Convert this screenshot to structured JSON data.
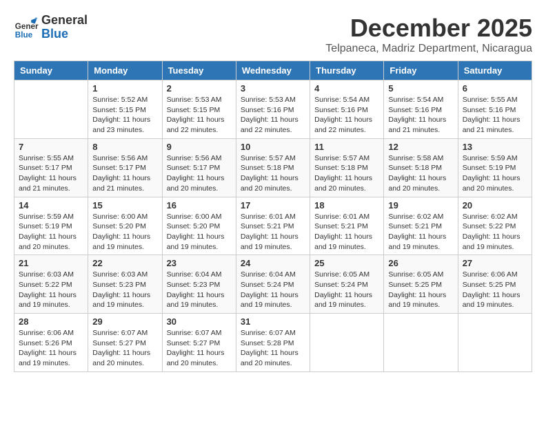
{
  "logo": {
    "line1": "General",
    "line2": "Blue"
  },
  "title": "December 2025",
  "location": "Telpaneca, Madriz Department, Nicaragua",
  "days_of_week": [
    "Sunday",
    "Monday",
    "Tuesday",
    "Wednesday",
    "Thursday",
    "Friday",
    "Saturday"
  ],
  "weeks": [
    [
      {
        "day": "",
        "info": ""
      },
      {
        "day": "1",
        "info": "Sunrise: 5:52 AM\nSunset: 5:15 PM\nDaylight: 11 hours\nand 23 minutes."
      },
      {
        "day": "2",
        "info": "Sunrise: 5:53 AM\nSunset: 5:15 PM\nDaylight: 11 hours\nand 22 minutes."
      },
      {
        "day": "3",
        "info": "Sunrise: 5:53 AM\nSunset: 5:16 PM\nDaylight: 11 hours\nand 22 minutes."
      },
      {
        "day": "4",
        "info": "Sunrise: 5:54 AM\nSunset: 5:16 PM\nDaylight: 11 hours\nand 22 minutes."
      },
      {
        "day": "5",
        "info": "Sunrise: 5:54 AM\nSunset: 5:16 PM\nDaylight: 11 hours\nand 21 minutes."
      },
      {
        "day": "6",
        "info": "Sunrise: 5:55 AM\nSunset: 5:16 PM\nDaylight: 11 hours\nand 21 minutes."
      }
    ],
    [
      {
        "day": "7",
        "info": "Sunrise: 5:55 AM\nSunset: 5:17 PM\nDaylight: 11 hours\nand 21 minutes."
      },
      {
        "day": "8",
        "info": "Sunrise: 5:56 AM\nSunset: 5:17 PM\nDaylight: 11 hours\nand 21 minutes."
      },
      {
        "day": "9",
        "info": "Sunrise: 5:56 AM\nSunset: 5:17 PM\nDaylight: 11 hours\nand 20 minutes."
      },
      {
        "day": "10",
        "info": "Sunrise: 5:57 AM\nSunset: 5:18 PM\nDaylight: 11 hours\nand 20 minutes."
      },
      {
        "day": "11",
        "info": "Sunrise: 5:57 AM\nSunset: 5:18 PM\nDaylight: 11 hours\nand 20 minutes."
      },
      {
        "day": "12",
        "info": "Sunrise: 5:58 AM\nSunset: 5:18 PM\nDaylight: 11 hours\nand 20 minutes."
      },
      {
        "day": "13",
        "info": "Sunrise: 5:59 AM\nSunset: 5:19 PM\nDaylight: 11 hours\nand 20 minutes."
      }
    ],
    [
      {
        "day": "14",
        "info": "Sunrise: 5:59 AM\nSunset: 5:19 PM\nDaylight: 11 hours\nand 20 minutes."
      },
      {
        "day": "15",
        "info": "Sunrise: 6:00 AM\nSunset: 5:20 PM\nDaylight: 11 hours\nand 19 minutes."
      },
      {
        "day": "16",
        "info": "Sunrise: 6:00 AM\nSunset: 5:20 PM\nDaylight: 11 hours\nand 19 minutes."
      },
      {
        "day": "17",
        "info": "Sunrise: 6:01 AM\nSunset: 5:21 PM\nDaylight: 11 hours\nand 19 minutes."
      },
      {
        "day": "18",
        "info": "Sunrise: 6:01 AM\nSunset: 5:21 PM\nDaylight: 11 hours\nand 19 minutes."
      },
      {
        "day": "19",
        "info": "Sunrise: 6:02 AM\nSunset: 5:21 PM\nDaylight: 11 hours\nand 19 minutes."
      },
      {
        "day": "20",
        "info": "Sunrise: 6:02 AM\nSunset: 5:22 PM\nDaylight: 11 hours\nand 19 minutes."
      }
    ],
    [
      {
        "day": "21",
        "info": "Sunrise: 6:03 AM\nSunset: 5:22 PM\nDaylight: 11 hours\nand 19 minutes."
      },
      {
        "day": "22",
        "info": "Sunrise: 6:03 AM\nSunset: 5:23 PM\nDaylight: 11 hours\nand 19 minutes."
      },
      {
        "day": "23",
        "info": "Sunrise: 6:04 AM\nSunset: 5:23 PM\nDaylight: 11 hours\nand 19 minutes."
      },
      {
        "day": "24",
        "info": "Sunrise: 6:04 AM\nSunset: 5:24 PM\nDaylight: 11 hours\nand 19 minutes."
      },
      {
        "day": "25",
        "info": "Sunrise: 6:05 AM\nSunset: 5:24 PM\nDaylight: 11 hours\nand 19 minutes."
      },
      {
        "day": "26",
        "info": "Sunrise: 6:05 AM\nSunset: 5:25 PM\nDaylight: 11 hours\nand 19 minutes."
      },
      {
        "day": "27",
        "info": "Sunrise: 6:06 AM\nSunset: 5:25 PM\nDaylight: 11 hours\nand 19 minutes."
      }
    ],
    [
      {
        "day": "28",
        "info": "Sunrise: 6:06 AM\nSunset: 5:26 PM\nDaylight: 11 hours\nand 19 minutes."
      },
      {
        "day": "29",
        "info": "Sunrise: 6:07 AM\nSunset: 5:27 PM\nDaylight: 11 hours\nand 20 minutes."
      },
      {
        "day": "30",
        "info": "Sunrise: 6:07 AM\nSunset: 5:27 PM\nDaylight: 11 hours\nand 20 minutes."
      },
      {
        "day": "31",
        "info": "Sunrise: 6:07 AM\nSunset: 5:28 PM\nDaylight: 11 hours\nand 20 minutes."
      },
      {
        "day": "",
        "info": ""
      },
      {
        "day": "",
        "info": ""
      },
      {
        "day": "",
        "info": ""
      }
    ]
  ]
}
